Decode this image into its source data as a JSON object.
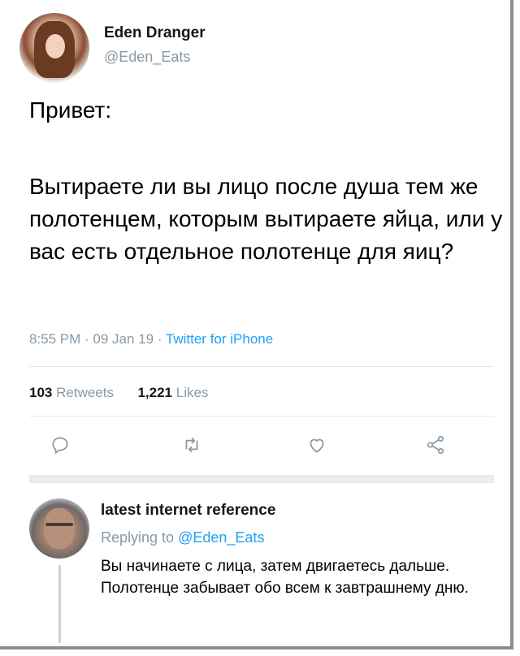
{
  "tweet": {
    "author_name": "Eden Dranger",
    "author_handle": "@Eden_Eats",
    "greeting": "Привет:",
    "text": "Вытираете ли вы лицо после душа тем же полотенцем, которым вытираете яйца, или у вас есть отдельное полотенце для яиц?",
    "timestamp": "8:55 PM · 09 Jan 19 · ",
    "client": "Twitter for iPhone",
    "retweets_count": "103",
    "retweets_label": "Retweets",
    "likes_count": "1,221",
    "likes_label": "Likes",
    "actions": [
      "reply-icon",
      "retweet-icon",
      "like-icon",
      "share-icon"
    ]
  },
  "reply": {
    "author_name": "latest internet reference",
    "replying_prefix": "Replying to ",
    "replying_to": "@Eden_Eats",
    "text": "Вы начинаете с лица, затем двигаетесь дальше. Полотенце забывает обо всем к завтрашнему дню."
  },
  "colors": {
    "link": "#1da1f2",
    "muted": "#8899a6",
    "divider": "#e1e8ed"
  }
}
